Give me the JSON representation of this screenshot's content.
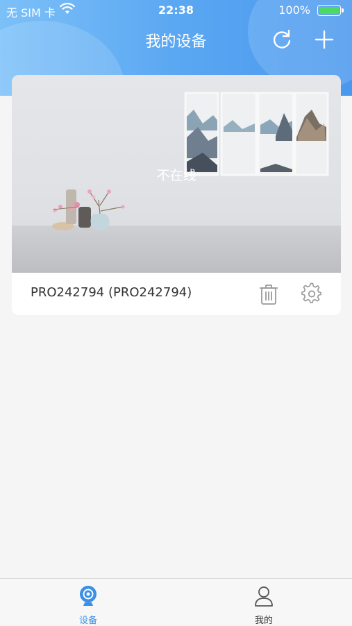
{
  "status_bar": {
    "carrier": "无 SIM 卡",
    "time": "22:38",
    "battery_percent": "100%"
  },
  "nav": {
    "title": "我的设备",
    "icons": [
      "refresh-icon",
      "add-icon"
    ]
  },
  "device_card": {
    "status_text": "不在线",
    "device_name": "PRO242794 (PRO242794)",
    "icons": [
      "trash-icon",
      "gear-icon"
    ]
  },
  "tabbar": {
    "tabs": [
      {
        "label": "设备",
        "icon": "camera-icon",
        "active": true
      },
      {
        "label": "我的",
        "icon": "person-icon",
        "active": false
      }
    ]
  },
  "colors": {
    "accent": "#3a8fe6",
    "header_gradient_start": "#7cc0f8",
    "header_gradient_end": "#4a98ee",
    "battery": "#4cd964",
    "background": "#f5f5f5"
  }
}
